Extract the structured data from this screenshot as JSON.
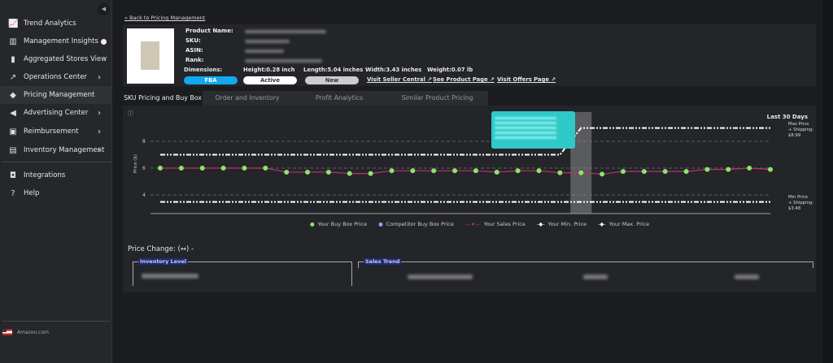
{
  "sidebar": {
    "items": [
      {
        "label": "Trend Analytics",
        "icon": "trend-chart-icon"
      },
      {
        "label": "Management Insights",
        "icon": "bar-chart-icon"
      },
      {
        "label": "Aggregated Stores View",
        "icon": "bars-icon"
      },
      {
        "label": "Operations Center",
        "icon": "trend-arrow-icon"
      },
      {
        "label": "Pricing Management",
        "icon": "tag-icon"
      },
      {
        "label": "Advertising Center",
        "icon": "megaphone-icon"
      },
      {
        "label": "Reimbursement",
        "icon": "clipboard-icon"
      },
      {
        "label": "Inventory Management",
        "icon": "archive-icon"
      },
      {
        "label": "Integrations",
        "icon": "plug-icon"
      },
      {
        "label": "Help",
        "icon": "help-icon"
      }
    ],
    "marketplace": "Amazon.com"
  },
  "back_link": "Back to Pricing Management",
  "product": {
    "labels": {
      "name": "Product Name:",
      "sku": "SKU:",
      "asin": "ASIN:",
      "rank": "Rank:",
      "dimensions": "Dimensions:"
    },
    "height": "Height:0.28 inch",
    "length": "Length:5.04 inches",
    "width": "Width:3.43 inches",
    "weight": "Weight:0.07 lb",
    "badges": {
      "fulfillment": "FBA",
      "status": "Active",
      "condition": "New"
    },
    "links": {
      "seller": "Visit Seller Central",
      "product": "See Product Page",
      "offers": "Visit Offers Page"
    }
  },
  "tabs": [
    "SKU Pricing and Buy Box",
    "Order and Inventory",
    "Profit Analytics",
    "Similar Product Pricing"
  ],
  "chart_data": {
    "type": "line",
    "title": "Last 30 Days",
    "ylabel": "Price ($)",
    "ylim": [
      2.6,
      10
    ],
    "yticks": [
      4,
      6,
      8
    ],
    "x": [
      1,
      2,
      3,
      4,
      5,
      6,
      7,
      8,
      9,
      10,
      11,
      12,
      13,
      14,
      15,
      16,
      17,
      18,
      19,
      20,
      21,
      22,
      23,
      24,
      25,
      26,
      27,
      28,
      29,
      30
    ],
    "series": [
      {
        "name": "Your Buy Box Price",
        "color": "#8fe36b",
        "values": [
          6,
          6,
          6,
          6,
          6,
          6,
          5.7,
          5.7,
          5.7,
          5.6,
          5.6,
          5.8,
          5.8,
          5.8,
          5.8,
          5.8,
          5.7,
          5.8,
          5.8,
          5.65,
          5.65,
          5.55,
          5.75,
          5.75,
          5.75,
          5.75,
          5.9,
          5.9,
          6,
          5.9
        ]
      },
      {
        "name": "Competitor Buy Box Price",
        "color": "#9a9af0",
        "values": []
      },
      {
        "name": "Your Sales Price",
        "color": "#c0306a",
        "values": [
          6,
          6,
          6,
          6,
          6,
          6,
          5.7,
          5.7,
          5.7,
          5.6,
          5.6,
          5.8,
          5.8,
          5.8,
          5.8,
          5.8,
          5.7,
          5.8,
          5.8,
          5.65,
          5.65,
          5.55,
          5.75,
          5.75,
          5.75,
          5.75,
          5.9,
          5.9,
          6,
          5.9
        ]
      },
      {
        "name": "Your Min. Price",
        "color": "#ffffff",
        "values": [
          3.48,
          3.48,
          3.48,
          3.48,
          3.48,
          3.48,
          3.48,
          3.48,
          3.48,
          3.48,
          3.48,
          3.48,
          3.48,
          3.48,
          3.48,
          3.48,
          3.48,
          3.48,
          3.48,
          3.48,
          3.48,
          3.48,
          3.48,
          3.48,
          3.48,
          3.48,
          3.48,
          3.48,
          3.48,
          3.48
        ]
      },
      {
        "name": "Your Max. Price",
        "color": "#ffffff",
        "values": [
          7,
          7,
          7,
          7,
          7,
          7,
          7,
          7,
          7,
          7,
          7,
          7,
          7,
          7,
          7,
          7,
          7,
          7,
          7,
          7,
          8.99,
          8.99,
          8.99,
          8.99,
          8.99,
          8.99,
          8.99,
          8.99,
          8.99,
          8.99
        ]
      }
    ],
    "highlight_day": 21,
    "annotations": {
      "max": [
        "Max Price",
        "+ Shipping:",
        "$8.99"
      ],
      "min": [
        "Min Price",
        "+ Shipping:",
        "$3.48"
      ]
    }
  },
  "price_change": "Price Change: (↔) -",
  "sections": {
    "inventory": "Inventory Level",
    "sales": "Sales Trend"
  }
}
